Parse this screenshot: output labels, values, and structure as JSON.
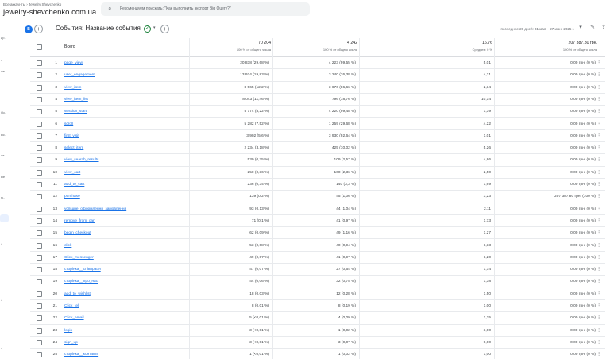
{
  "header": {
    "breadcrumb": "Все аккаунты › Jewelry Shevchenko",
    "property": "jewelry-shevchenko.com.ua...",
    "search_placeholder": "Рекомендуем поискать: \"Как выполнить экспорт Big Query?\""
  },
  "rail": {
    "labels": [
      "ир..",
      "ми",
      "Ос..",
      "ыс..",
      "ие..",
      "ые",
      "ю.."
    ]
  },
  "toolbar": {
    "badge": "B",
    "dimension_label": "События: Название события",
    "date_range": "последние 28 дней:  31 мая – 27 июн. 2025 г."
  },
  "table": {
    "total_label": "Всего",
    "totals": [
      "70 204",
      "4 242",
      "16,76",
      "207 387,80 грн."
    ],
    "total_subs": [
      "100 % от общего числа",
      "100 % от общего числа",
      "Среднее: 0 %",
      "100 % от общего числа"
    ],
    "rows": [
      {
        "n": "1",
        "name": "page_view",
        "c1": "20 838 (29,68 %)",
        "c2": "4 223 (99,55 %)",
        "c3": "5,01",
        "c4": "0,00 грн. (0 %)"
      },
      {
        "n": "2",
        "name": "user_engagement",
        "c1": "13 924 (19,83 %)",
        "c2": "3 240 (76,38 %)",
        "c3": "4,31",
        "c4": "0,00 грн. (0 %)"
      },
      {
        "n": "3",
        "name": "view_item",
        "c1": "8 565 (12,2 %)",
        "c2": "3 676 (86,66 %)",
        "c3": "2,34",
        "c4": "0,00 грн. (0 %)"
      },
      {
        "n": "4",
        "name": "view_item_list",
        "c1": "8 043 (11,46 %)",
        "c2": "796 (18,76 %)",
        "c3": "10,14",
        "c4": "0,00 грн. (0 %)"
      },
      {
        "n": "5",
        "name": "session_start",
        "c1": "5 774 (8,22 %)",
        "c2": "4 220 (99,48 %)",
        "c3": "1,39",
        "c4": "0,00 грн. (0 %)"
      },
      {
        "n": "6",
        "name": "scroll",
        "c1": "5 282 (7,52 %)",
        "c2": "1 259 (29,68 %)",
        "c3": "4,22",
        "c4": "0,00 грн. (0 %)"
      },
      {
        "n": "7",
        "name": "first_visit",
        "c1": "3 902 (5,6 %)",
        "c2": "3 930 (92,64 %)",
        "c3": "1,01",
        "c4": "0,00 грн. (0 %)"
      },
      {
        "n": "8",
        "name": "select_item",
        "c1": "2 234 (3,18 %)",
        "c2": "425 (10,02 %)",
        "c3": "5,26",
        "c4": "0,00 грн. (0 %)"
      },
      {
        "n": "9",
        "name": "view_search_results",
        "c1": "530 (0,75 %)",
        "c2": "109 (2,57 %)",
        "c3": "4,86",
        "c4": "0,00 грн. (0 %)"
      },
      {
        "n": "10",
        "name": "view_cart",
        "c1": "250 (0,36 %)",
        "c2": "100 (2,36 %)",
        "c3": "2,50",
        "c4": "0,00 грн. (0 %)"
      },
      {
        "n": "11",
        "name": "add_to_cart",
        "c1": "236 (0,34 %)",
        "c2": "140 (3,3 %)",
        "c3": "1,69",
        "c4": "0,00 грн. (0 %)"
      },
      {
        "n": "12",
        "name": "purchase",
        "c1": "139 (0,2 %)",
        "c2": "45 (1,06 %)",
        "c3": "3,23",
        "c4": "207 387,80 грн. (100 %)"
      },
      {
        "n": "13",
        "name": "успішне_оформлення_замовлення",
        "c1": "93 (0,13 %)",
        "c2": "44 (1,04 %)",
        "c3": "2,11",
        "c4": "0,00 грн. (0 %)"
      },
      {
        "n": "14",
        "name": "remove_from_cart",
        "c1": "71 (0,1 %)",
        "c2": "41 (0,97 %)",
        "c3": "1,73",
        "c4": "0,00 грн. (0 %)"
      },
      {
        "n": "15",
        "name": "begin_checkout",
        "c1": "62 (0,09 %)",
        "c2": "49 (1,16 %)",
        "c3": "1,27",
        "c4": "0,00 грн. (0 %)"
      },
      {
        "n": "16",
        "name": "click",
        "c1": "53 (0,08 %)",
        "c2": "40 (0,94 %)",
        "c3": "1,33",
        "c4": "0,00 грн. (0 %)"
      },
      {
        "n": "17",
        "name": "Click_messenger",
        "c1": "49 (0,07 %)",
        "c2": "41 (0,97 %)",
        "c3": "1,20",
        "c4": "0,00 грн. (0 %)"
      },
      {
        "n": "18",
        "name": "сторінка__співпраця",
        "c1": "47 (0,07 %)",
        "c2": "27 (0,64 %)",
        "c3": "1,74",
        "c4": "0,00 грн. (0 %)"
      },
      {
        "n": "19",
        "name": "сторінка__про_нас",
        "c1": "44 (0,06 %)",
        "c2": "32 (0,75 %)",
        "c3": "1,38",
        "c4": "0,00 грн. (0 %)"
      },
      {
        "n": "20",
        "name": "add_to_wishlist",
        "c1": "18 (0,03 %)",
        "c2": "12 (0,28 %)",
        "c3": "1,50",
        "c4": "0,00 грн. (0 %)"
      },
      {
        "n": "21",
        "name": "Click_tel",
        "c1": "8 (0,01 %)",
        "c2": "8 (0,19 %)",
        "c3": "1,00",
        "c4": "0,00 грн. (0 %)"
      },
      {
        "n": "22",
        "name": "Click_email",
        "c1": "5 (<0,01 %)",
        "c2": "4 (0,09 %)",
        "c3": "1,25",
        "c4": "0,00 грн. (0 %)"
      },
      {
        "n": "23",
        "name": "login",
        "c1": "3 (<0,01 %)",
        "c2": "1 (0,02 %)",
        "c3": "3,00",
        "c4": "0,00 грн. (0 %)"
      },
      {
        "n": "24",
        "name": "sign_up",
        "c1": "3 (<0,01 %)",
        "c2": "3 (0,07 %)",
        "c3": "0,00",
        "c4": "0,00 грн. (0 %)"
      },
      {
        "n": "25",
        "name": "сторінка__контакти",
        "c1": "1 (<0,01 %)",
        "c2": "1 (0,02 %)",
        "c3": "1,00",
        "c4": "0,00 грн. (0 %)"
      }
    ]
  }
}
